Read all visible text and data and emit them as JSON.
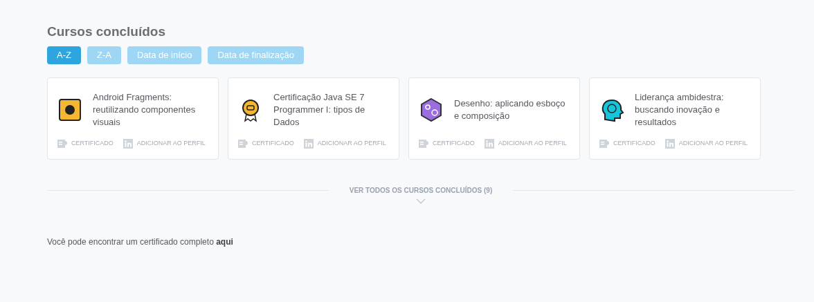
{
  "heading": "Cursos concluídos",
  "sort_buttons": [
    {
      "label": "A-Z",
      "selected": true
    },
    {
      "label": "Z-A",
      "selected": false
    },
    {
      "label": "Data de início",
      "selected": false
    },
    {
      "label": "Data de finalização",
      "selected": false
    }
  ],
  "courses": [
    {
      "title": "Android Fragments: reutilizando componentes visuais",
      "color": "#f5b731",
      "certificate": "CERTIFICADO",
      "profile": "ADICIONAR AO PERFIL"
    },
    {
      "title": "Certificação Java SE 7 Programmer I: tipos de Dados",
      "color": "#f5b731",
      "certificate": "CERTIFICADO",
      "profile": "ADICIONAR AO PERFIL"
    },
    {
      "title": "Desenho: aplicando esboço e composição",
      "color": "#9b6ee0",
      "certificate": "CERTIFICADO",
      "profile": "ADICIONAR AO PERFIL"
    },
    {
      "title": "Liderança ambidestra: buscando inovação e resultados",
      "color": "#16c4dc",
      "certificate": "CERTIFICADO",
      "profile": "ADICIONAR AO PERFIL"
    }
  ],
  "see_all": "VER TODOS OS CURSOS CONCLUÍDOS (9)",
  "footer": {
    "text": "Você pode encontrar um certificado completo",
    "link": "aqui"
  }
}
